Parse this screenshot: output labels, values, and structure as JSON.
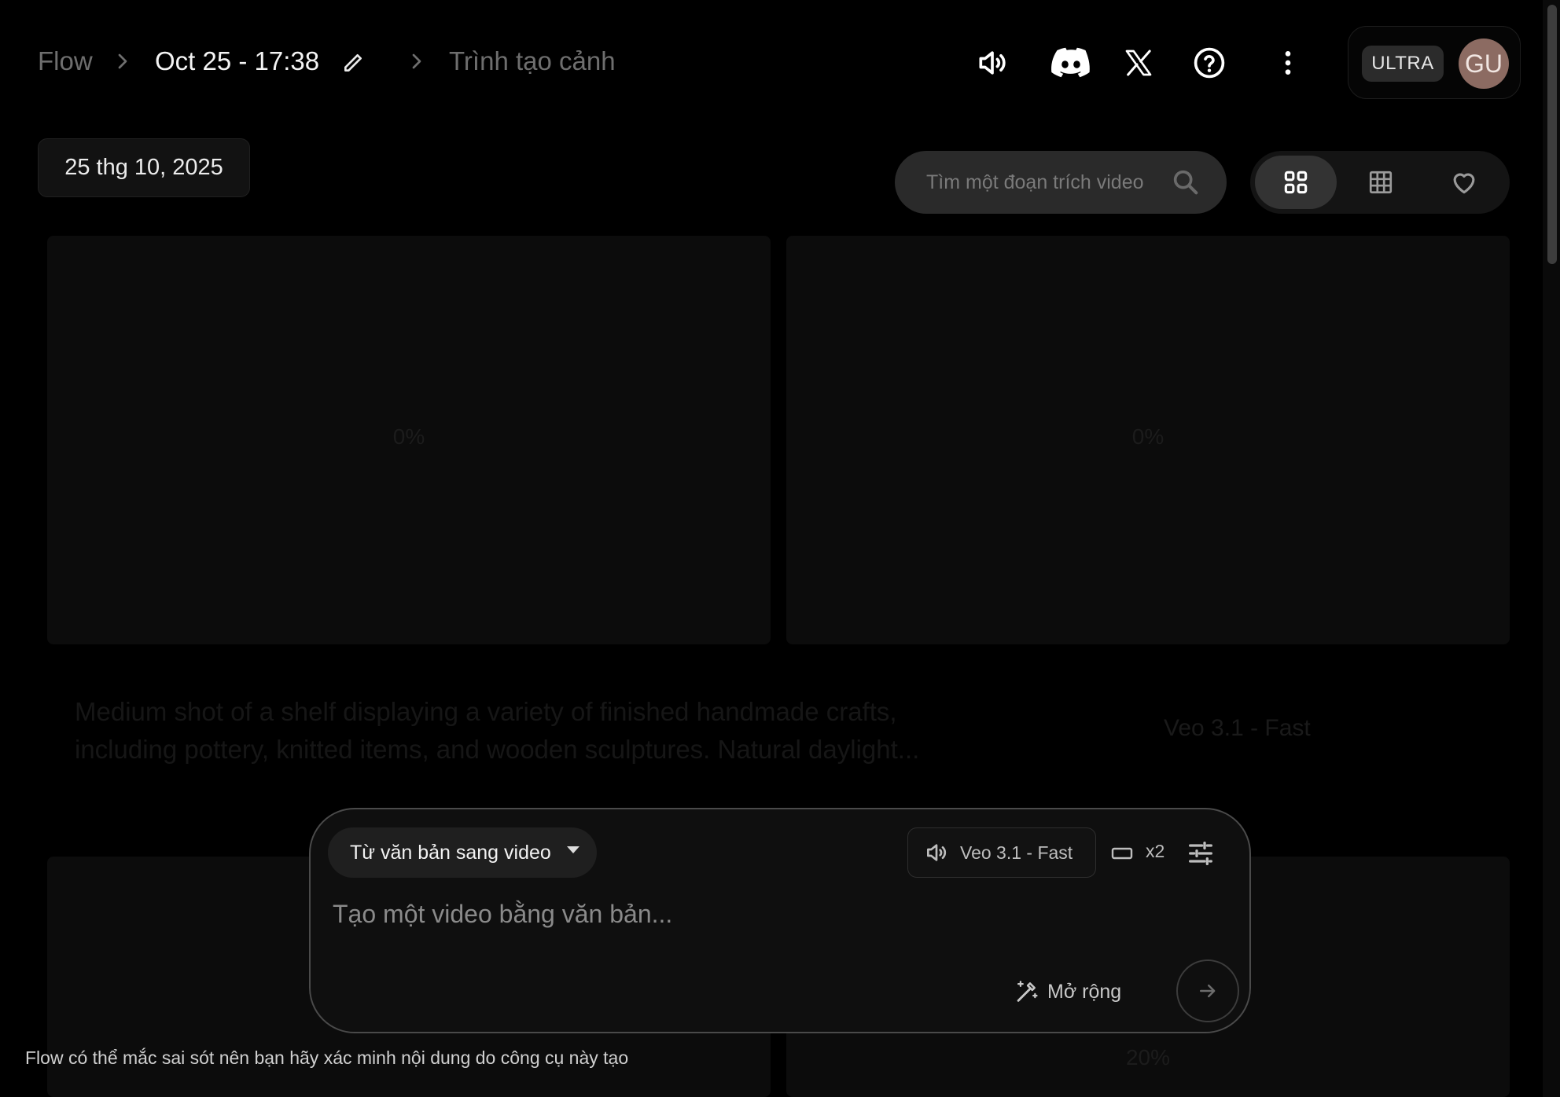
{
  "breadcrumb": {
    "root": "Flow",
    "project": "Oct 25 - 17:38",
    "current": "Trình tạo cảnh"
  },
  "header_icons": [
    "volume-icon",
    "discord-icon",
    "x-logo-icon",
    "help-icon",
    "more-vert-icon"
  ],
  "account": {
    "plan": "ULTRA",
    "initials": "GU",
    "avatar_color": "#8c6b62"
  },
  "toolbar": {
    "date": "25 thg 10, 2025",
    "search_placeholder": "Tìm một đoạn trích video",
    "views": [
      "grid-view-icon",
      "dense-grid-view-icon",
      "favorites-heart-icon"
    ],
    "active_view": 0
  },
  "background_content": {
    "cards": [
      {
        "progress": "0%"
      },
      {
        "progress": "0%"
      },
      {
        "progress": "20%"
      }
    ],
    "prompt_text": "Medium shot of a shelf displaying a variety of finished handmade crafts, including pottery, knitted items, and wooden sculptures. Natural daylight...",
    "model": "Veo 3.1 - Fast"
  },
  "composer": {
    "mode": "Từ văn bản sang video",
    "model": "Veo 3.1 - Fast",
    "output_count": "x2",
    "placeholder": "Tạo một video bằng văn bản...",
    "expand_label": "Mở rộng"
  },
  "disclaimer": "Flow có thể mắc sai sót nên bạn hãy xác minh nội dung do công cụ này tạo"
}
